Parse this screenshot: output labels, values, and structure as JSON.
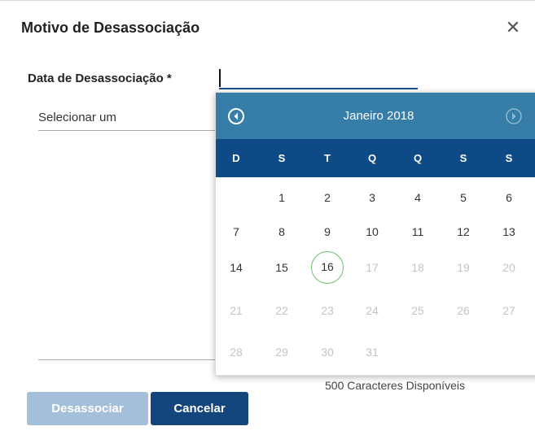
{
  "dialog": {
    "title": "Motivo de Desassociação",
    "close_symbol": "✕",
    "close_icon": "close-icon"
  },
  "form": {
    "date_label": "Data de Desassociação *",
    "reason_select_value": "Selecionar um",
    "char_counter": "500 Caracteres Disponíveis"
  },
  "buttons": {
    "disassociate": "Desassociar",
    "cancel": "Cancelar"
  },
  "calendar": {
    "month_year": "Janeiro 2018",
    "prev_icon": "chevron-left-circle-icon",
    "next_icon": "chevron-right-circle-icon",
    "weekdays": [
      "D",
      "S",
      "T",
      "Q",
      "Q",
      "S",
      "S"
    ],
    "weeks": [
      [
        "",
        "1",
        "2",
        "3",
        "4",
        "5",
        "6"
      ],
      [
        "7",
        "8",
        "9",
        "10",
        "11",
        "12",
        "13"
      ],
      [
        "14",
        "15",
        "16",
        "17",
        "18",
        "19",
        "20"
      ],
      [
        "21",
        "22",
        "23",
        "24",
        "25",
        "26",
        "27"
      ],
      [
        "28",
        "29",
        "30",
        "31",
        "",
        "",
        ""
      ]
    ],
    "today": "16",
    "last_selectable_day": "16"
  },
  "colors": {
    "header": "#367ea7",
    "weekday_bar": "#0e4a85",
    "primary_button": "#14457d",
    "disabled_button": "#a4bfd9",
    "today_ring": "#6cbf6a"
  }
}
